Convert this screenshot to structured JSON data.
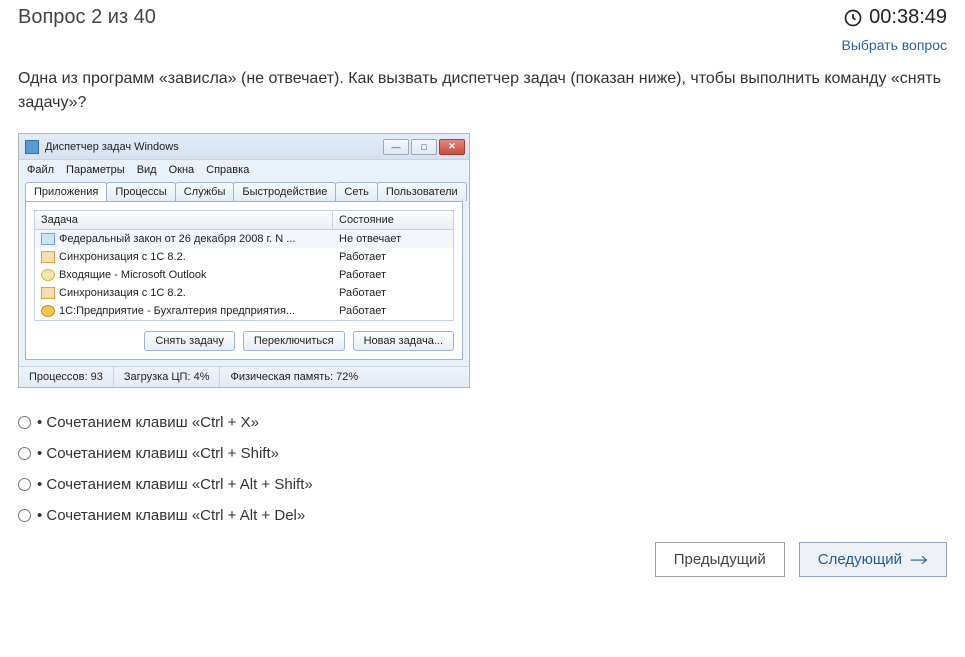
{
  "header": {
    "title": "Вопрос 2 из 40",
    "timer": "00:38:49",
    "select_link": "Выбрать вопрос"
  },
  "prompt": "Одна из программ «зависла» (не отвечает). Как вызвать диспетчер задач (показан ниже), чтобы выполнить команду «снять задачу»?",
  "taskmgr": {
    "title": "Диспетчер задач Windows",
    "menu": {
      "file": "Файл",
      "params": "Параметры",
      "view": "Вид",
      "windows": "Окна",
      "help": "Справка"
    },
    "tabs": {
      "apps": "Приложения",
      "procs": "Процессы",
      "svcs": "Службы",
      "perf": "Быстродействие",
      "net": "Сеть",
      "users": "Пользователи"
    },
    "columns": {
      "task": "Задача",
      "state": "Состояние"
    },
    "rows": [
      {
        "icon": "ico-doc",
        "task": "Федеральный закон от 26 декабря 2008 г. N ...",
        "state": "Не отвечает"
      },
      {
        "icon": "ico-sync",
        "task": "Синхронизация с 1С 8.2.",
        "state": "Работает"
      },
      {
        "icon": "ico-mail",
        "task": "Входящие - Microsoft Outlook",
        "state": "Работает"
      },
      {
        "icon": "ico-sync",
        "task": "Синхронизация с 1С 8.2.",
        "state": "Работает"
      },
      {
        "icon": "ico-1c",
        "task": "1С:Предприятие - Бухгалтерия предприятия...",
        "state": "Работает"
      }
    ],
    "buttons": {
      "end": "Снять задачу",
      "switch": "Переключиться",
      "new": "Новая задача..."
    },
    "status": {
      "procs": "Процессов: 93",
      "cpu": "Загрузка ЦП: 4%",
      "mem": "Физическая память: 72%"
    }
  },
  "answers": {
    "a1": "• Сочетанием клавиш «Ctrl + X»",
    "a2": "• Сочетанием клавиш «Ctrl + Shift»",
    "a3": "• Сочетанием клавиш «Ctrl + Alt + Shift»",
    "a4": "• Сочетанием клавиш «Ctrl + Alt + Del»"
  },
  "nav": {
    "prev": "Предыдущий",
    "next": "Следующий"
  }
}
